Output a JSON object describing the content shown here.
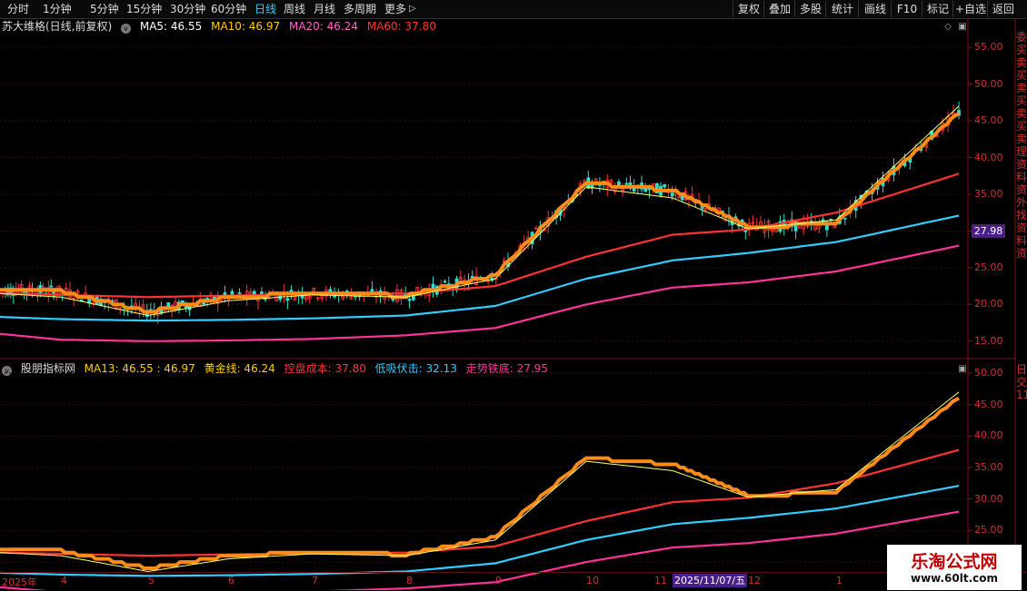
{
  "toolbar": {
    "periods": [
      "分时",
      "1分钟",
      "5分钟",
      "15分钟",
      "30分钟",
      "60分钟",
      "日线",
      "周线",
      "月线",
      "多周期",
      "更多"
    ],
    "active_period": "日线",
    "more_arrow": "▷",
    "right_buttons": [
      "复权",
      "叠加",
      "多股",
      "统计",
      "画线",
      "F10",
      "标记",
      "+自选",
      "返回"
    ]
  },
  "main_panel": {
    "title": "苏大维格(日线,前复权)",
    "indicators": [
      {
        "label": "MA5: 46.55",
        "color": "#ffffff"
      },
      {
        "label": "MA10: 46.97",
        "color": "#ffcc00"
      },
      {
        "label": "MA20: 46.24",
        "color": "#ff66cc"
      },
      {
        "label": "MA60: 37.80",
        "color": "#ff3333"
      }
    ],
    "y_ticks": [
      "55.00",
      "50.00",
      "45.00",
      "40.00",
      "35.00",
      "30.00",
      "25.00",
      "20.00",
      "15.00"
    ],
    "current_price": "27.98",
    "right_side_text": "委买卖买卖买卖买卖理资料资外找资料资"
  },
  "sub_panel": {
    "title": "股朋指标网",
    "indicators": [
      {
        "label": "MA13: 46.55 : 46.97",
        "color": "#ffcc00"
      },
      {
        "label": "黄金线: 46.24",
        "color": "#ffcc00"
      },
      {
        "label": "控盘成本: 37.80",
        "color": "#ff3333"
      },
      {
        "label": "低吸伏击: 32.13",
        "color": "#33ccff"
      },
      {
        "label": "走势铁底: 27.95",
        "color": "#ff3399"
      }
    ],
    "y_ticks": [
      "50.00",
      "45.00",
      "40.00",
      "35.00",
      "30.00",
      "25.00",
      "20.00"
    ],
    "right_side_text": "日交1111111111"
  },
  "x_axis": {
    "labels": [
      "2025年",
      "4",
      "5",
      "6",
      "7",
      "8",
      "9",
      "10",
      "11",
      "12",
      "1"
    ],
    "highlight": "2025/11/07/五"
  },
  "watermark": {
    "line1": "乐淘公式网",
    "line2": "www.60lt.com"
  },
  "chart_data": [
    {
      "type": "line",
      "title": "苏大维格(日线,前复权)",
      "xlabel": "",
      "ylabel": "",
      "ylim": [
        13,
        57
      ],
      "x": [
        "2025-03",
        "2025-04",
        "2025-05",
        "2025-06",
        "2025-07",
        "2025-08",
        "2025-09",
        "2025-10",
        "2025-11",
        "2025-12",
        "2026-01",
        "2026-02"
      ],
      "series": [
        {
          "name": "MA60",
          "color": "#ff3333",
          "values": [
            21.5,
            21.3,
            21.0,
            21.2,
            21.4,
            21.5,
            22.5,
            26.5,
            29.5,
            30.2,
            32.5,
            37.8
          ]
        },
        {
          "name": "",
          "color": "#33ccff",
          "values": [
            18.3,
            18.0,
            17.8,
            17.9,
            18.1,
            18.5,
            19.8,
            23.5,
            26.0,
            27.0,
            28.5,
            32.1
          ]
        },
        {
          "name": "",
          "color": "#ff3399",
          "values": [
            16.0,
            15.2,
            15.0,
            15.1,
            15.3,
            15.8,
            16.8,
            20.0,
            22.3,
            23.0,
            24.5,
            28.0
          ]
        },
        {
          "name": "",
          "color": "#ff8c1a",
          "values": [
            22.0,
            21.8,
            19.0,
            21.0,
            21.5,
            21.2,
            24.0,
            36.5,
            35.5,
            30.5,
            31.0,
            46.2
          ]
        },
        {
          "name": "MA5",
          "color": "#ffff66",
          "values": [
            21.5,
            21.0,
            18.5,
            20.5,
            21.3,
            21.0,
            23.5,
            36.0,
            34.5,
            30.3,
            31.5,
            47.0
          ]
        }
      ]
    },
    {
      "type": "line",
      "title": "股朋指标网",
      "xlabel": "",
      "ylabel": "",
      "ylim": [
        19,
        51
      ],
      "x": [
        "2025-03",
        "2025-04",
        "2025-05",
        "2025-06",
        "2025-07",
        "2025-08",
        "2025-09",
        "2025-10",
        "2025-11",
        "2025-12",
        "2026-01",
        "2026-02"
      ],
      "series": [
        {
          "name": "控盘成本",
          "color": "#ff3333",
          "values": [
            21.5,
            21.3,
            21.0,
            21.2,
            21.4,
            21.5,
            22.5,
            26.5,
            29.5,
            30.2,
            32.5,
            37.8
          ]
        },
        {
          "name": "低吸伏击",
          "color": "#33ccff",
          "values": [
            18.3,
            18.0,
            17.8,
            17.9,
            18.1,
            18.5,
            19.8,
            23.5,
            26.0,
            27.0,
            28.5,
            32.1
          ]
        },
        {
          "name": "走势铁底",
          "color": "#ff3399",
          "values": [
            16.0,
            15.2,
            15.0,
            15.1,
            15.3,
            15.8,
            16.8,
            20.0,
            22.3,
            23.0,
            24.5,
            28.0
          ]
        },
        {
          "name": "黄金线",
          "color": "#ff8c1a",
          "values": [
            22.0,
            21.8,
            19.0,
            21.0,
            21.5,
            21.2,
            24.0,
            36.5,
            35.5,
            30.5,
            31.0,
            46.2
          ]
        },
        {
          "name": "MA13",
          "color": "#ffff66",
          "values": [
            21.5,
            21.0,
            18.5,
            20.5,
            21.3,
            21.0,
            23.5,
            36.0,
            34.5,
            30.3,
            31.5,
            47.0
          ]
        }
      ]
    }
  ]
}
